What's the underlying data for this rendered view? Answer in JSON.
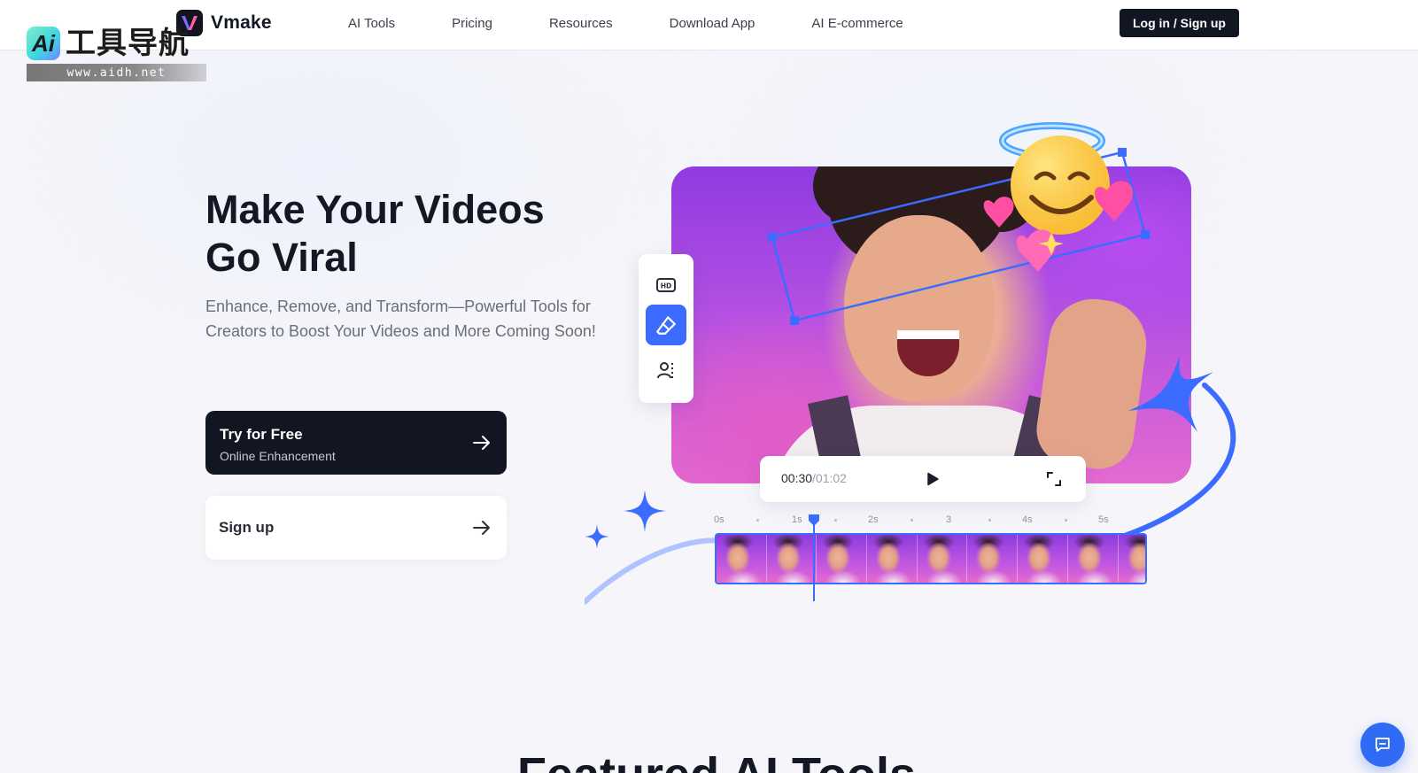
{
  "brand": {
    "name": "Vmake"
  },
  "nav": {
    "items": [
      {
        "label": "AI Tools"
      },
      {
        "label": "Pricing"
      },
      {
        "label": "Resources"
      },
      {
        "label": "Download App"
      },
      {
        "label": "AI E-commerce"
      }
    ],
    "login_label": "Log in / Sign up"
  },
  "watermark": {
    "badge": "Ai",
    "text": "工具导航",
    "url": "www.aidh.net"
  },
  "hero": {
    "title_line1": "Make Your Videos",
    "title_line2": "Go Viral",
    "subtitle": "Enhance, Remove, and Transform—Powerful Tools for Creators to Boost Your Videos and More Coming Soon!",
    "cta_primary": {
      "title": "Try for Free",
      "subtitle": "Online Enhancement"
    },
    "cta_secondary": {
      "title": "Sign up"
    }
  },
  "editor": {
    "tools": [
      {
        "icon": "hd-icon",
        "active": false
      },
      {
        "icon": "eraser-icon",
        "active": true
      },
      {
        "icon": "person-cutout-icon",
        "active": false
      }
    ],
    "player": {
      "current_time": "00:30",
      "total_time": "/01:02"
    },
    "ruler_labels": [
      "0s",
      "1s",
      "2s",
      "3",
      "4s",
      "5s"
    ],
    "filmstrip_frames": 9,
    "playhead_position": 0.23
  },
  "section": {
    "featured_title": "Featured AI Tools"
  },
  "colors": {
    "accent": "#3b6cff",
    "dark": "#121522",
    "chat": "#2f6bf4"
  }
}
